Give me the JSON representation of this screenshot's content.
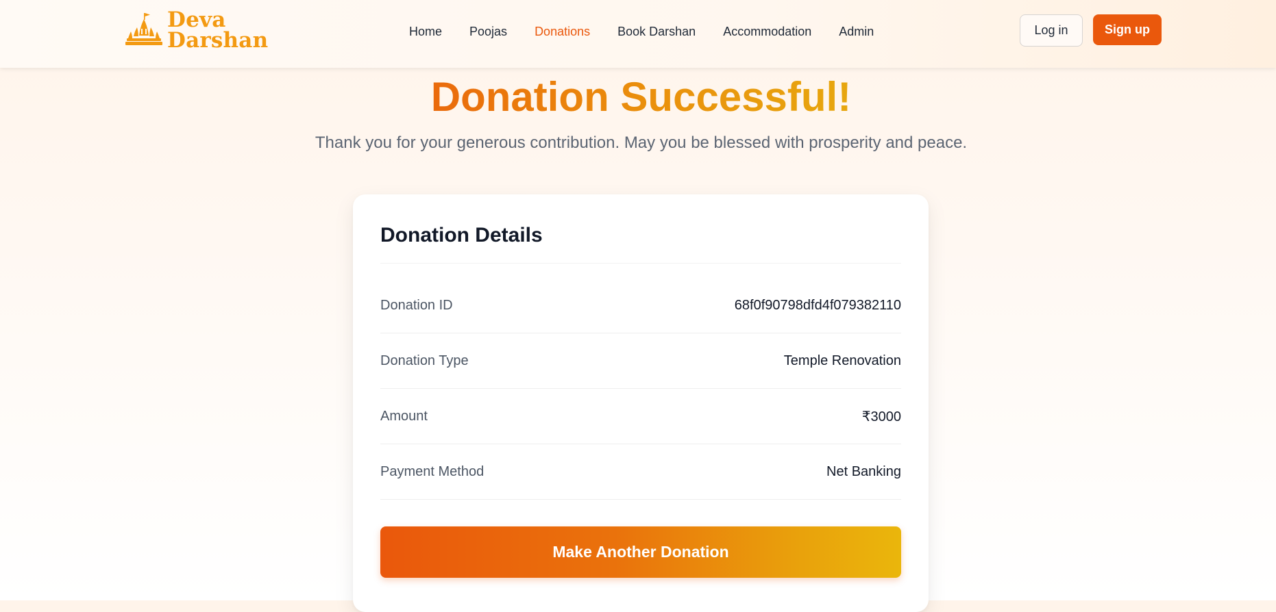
{
  "brand": {
    "line1": "Deva",
    "line2": "Darshan",
    "logo_icon": "temple-icon",
    "color": "#f39a12"
  },
  "nav": {
    "links": [
      {
        "label": "Home",
        "active": false
      },
      {
        "label": "Poojas",
        "active": false
      },
      {
        "label": "Donations",
        "active": true
      },
      {
        "label": "Book Darshan",
        "active": false
      },
      {
        "label": "Accommodation",
        "active": false
      },
      {
        "label": "Admin",
        "active": false
      }
    ],
    "login_label": "Log in",
    "signup_label": "Sign up"
  },
  "hero": {
    "title": "Donation Successful!",
    "subtitle": "Thank you for your generous contribution. May you be blessed with prosperity and peace."
  },
  "card": {
    "title": "Donation Details",
    "rows": [
      {
        "label": "Donation ID",
        "value": "68f0f90798dfd4f079382110"
      },
      {
        "label": "Donation Type",
        "value": "Temple Renovation"
      },
      {
        "label": "Amount",
        "value": "₹3000"
      },
      {
        "label": "Payment Method",
        "value": "Net Banking"
      }
    ],
    "button_label": "Make Another Donation"
  },
  "colors": {
    "accent": "#ea580c",
    "gradient_end": "#eab60c",
    "active_nav": "#ea580c"
  }
}
